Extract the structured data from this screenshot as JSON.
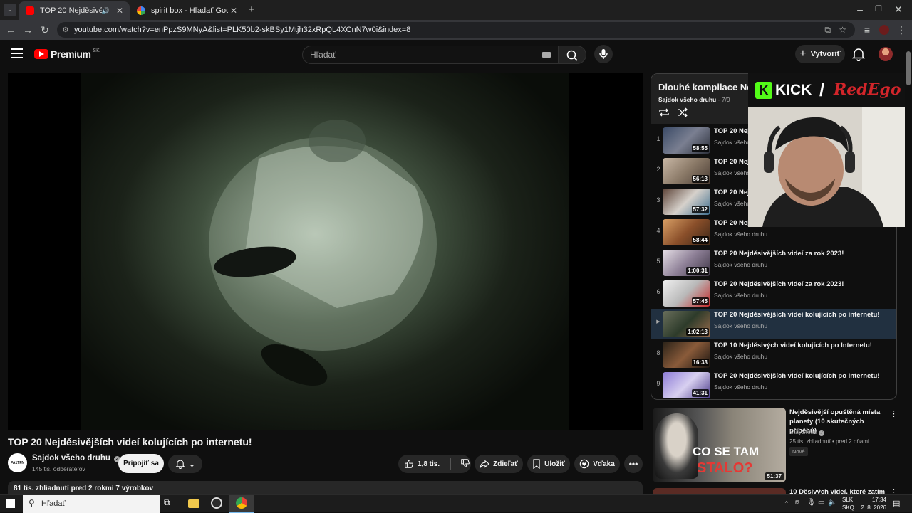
{
  "browser": {
    "tabs": [
      {
        "title": "TOP 20 Nejděsivějších vide",
        "active": true
      },
      {
        "title": "spirit box - Hľadať Googlom",
        "active": false
      }
    ],
    "url": "youtube.com/watch?v=enPpzS9MNyA&list=PLK50b2-skBSy1Mtjh32xRpQL4XCnN7w0i&index=8"
  },
  "header": {
    "logo": "Premium",
    "region": "SK",
    "search_placeholder": "Hľadať",
    "create_label": "Vytvoriť"
  },
  "video": {
    "title": "TOP 20 Nejděsivějších videí kolujících po internetu!",
    "channel": "Sajdok všeho druhu",
    "subscribers": "145 tis. odberateľov",
    "subscribe_label": "Pripojiť sa",
    "likes": "1,8 tis.",
    "share_label": "Zdieľať",
    "save_label": "Uložiť",
    "thanks_label": "Vďaka",
    "meta": "81 tis. zhliadnutí  pred 2 rokmi  7 výrobkov",
    "avatar_text": "PA1TFN"
  },
  "playlist": {
    "title": "Dlouhé kompilace Ne",
    "channel": "Sajdok všeho druhu",
    "position": "- 7/9",
    "items": [
      {
        "index": "1",
        "title": "TOP 20 Nejd",
        "channel": "Sajdok všeho",
        "duration": "58:55"
      },
      {
        "index": "2",
        "title": "TOP 20 Nejd",
        "channel": "Sajdok všeho",
        "duration": "56:13"
      },
      {
        "index": "3",
        "title": "TOP 20 Nejd",
        "channel": "Sajdok všeho",
        "duration": "57:32"
      },
      {
        "index": "4",
        "title": "TOP 20 Nejd",
        "channel": "Sajdok všeho druhu",
        "duration": "58:44"
      },
      {
        "index": "5",
        "title": "TOP 20 Nejděsivějších videí za rok 2023!",
        "channel": "Sajdok všeho druhu",
        "duration": "1:00:31"
      },
      {
        "index": "6",
        "title": "TOP 20 Nejděsivějších videí za rok 2023!",
        "channel": "Sajdok všeho druhu",
        "duration": "57:45"
      },
      {
        "index": "▶",
        "title": "TOP 20 Nejděsivějších videí kolujících po internetu!",
        "channel": "Sajdok všeho druhu",
        "duration": "1:02:13",
        "current": true
      },
      {
        "index": "8",
        "title": "TOP 10 Nejděsivých videí kolujících po Internetu!",
        "channel": "Sajdok všeho druhu",
        "duration": "16:33"
      },
      {
        "index": "9",
        "title": "TOP 20 Nejděsivějších videí kolujících po internetu!",
        "channel": "Sajdok všeho druhu",
        "duration": "41:31"
      }
    ]
  },
  "recommendations": [
    {
      "title_line1": "Nejděsivější opuštěná místa",
      "title_line2": "planety (10 skutečných příběhů)",
      "channel": "StaySteak",
      "meta": "25 tis. zhliadnutí  • pred 2 dňami",
      "badge": "Nové",
      "duration": "51:37",
      "thumb_text1": "CO SE TAM",
      "thumb_text2": "STALO?"
    },
    {
      "title_line1": "10 Děsivých videí, které zatím"
    }
  ],
  "overlay": {
    "kick": "KICK",
    "slash": "/",
    "brand": "RedEgo"
  },
  "taskbar": {
    "search_placeholder": "Hľadať",
    "lang1": "SLK",
    "lang2": "SKQ",
    "time": "17:34",
    "date": "2. 8. 2026"
  }
}
